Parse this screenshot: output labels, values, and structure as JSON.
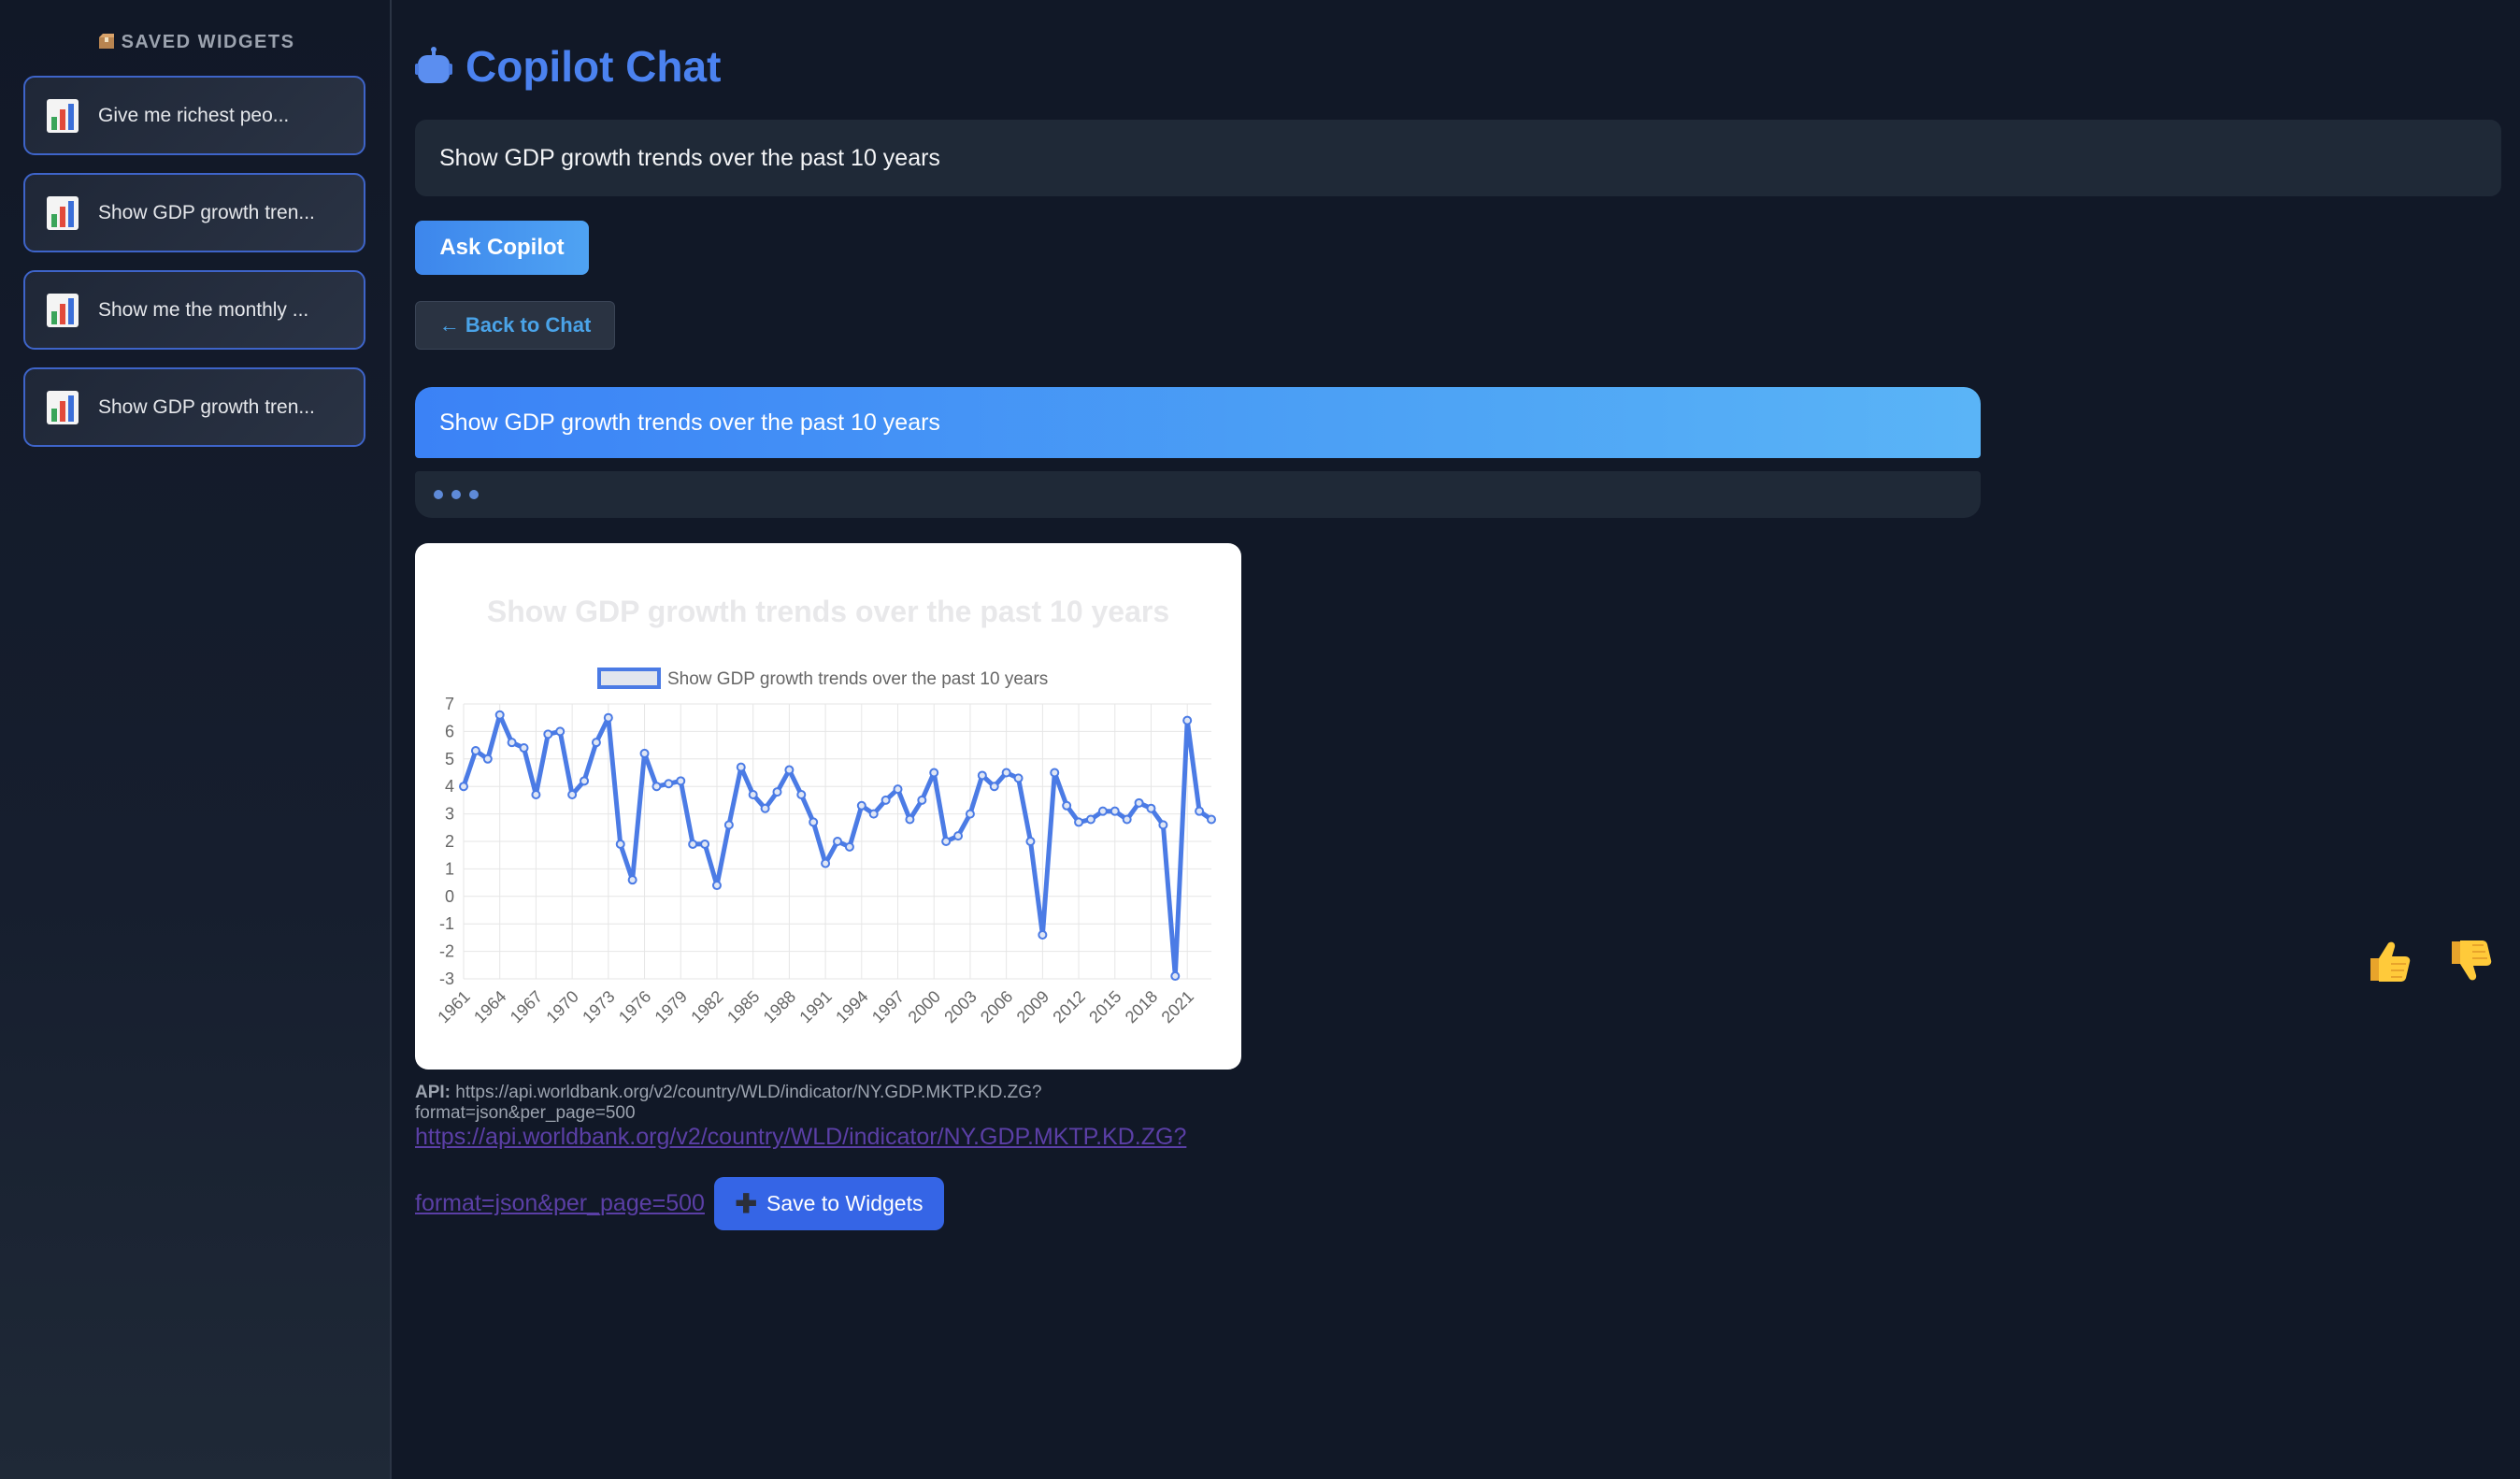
{
  "sidebar": {
    "title": "SAVED WIDGETS",
    "title_icon": "package-icon",
    "items": [
      {
        "label": "Give me richest peo...",
        "icon": "bar-chart-icon"
      },
      {
        "label": "Show GDP growth tren...",
        "icon": "bar-chart-icon"
      },
      {
        "label": "Show me the monthly ...",
        "icon": "bar-chart-icon"
      },
      {
        "label": "Show GDP growth tren...",
        "icon": "bar-chart-icon"
      }
    ]
  },
  "header": {
    "title": "Copilot Chat",
    "icon": "robot-icon"
  },
  "query": {
    "value": "Show GDP growth trends over the past 10 years"
  },
  "buttons": {
    "ask": "Ask Copilot",
    "back": "← Back to Chat",
    "save": "Save to Widgets",
    "save_icon": "plus-icon"
  },
  "chat": {
    "user_message": "Show GDP growth trends over the past 10 years"
  },
  "api": {
    "label": "API:",
    "url_line1": "https://api.worldbank.org/v2/country/WLD/indicator/NY.GDP.MKTP.KD.ZG?",
    "url_line2": "format=json&per_page=500",
    "link_line1": "https://api.worldbank.org/v2/country/WLD/indicator/NY.GDP.MKTP.KD.ZG?",
    "link_line2": "format=json&per_page=500"
  },
  "feedback": {
    "thumbs_up": "thumbs-up-icon",
    "thumbs_down": "thumbs-down-icon"
  },
  "colors": {
    "accent": "#3b82f6",
    "line": "#4b7be5",
    "background": "#111827"
  },
  "chart_data": {
    "type": "line",
    "title": "Show GDP growth trends over the past 10 years",
    "legend": "top",
    "xlabel": "",
    "ylabel": "",
    "ylim": [
      -3,
      7
    ],
    "yticks": [
      7,
      6,
      5,
      4,
      3,
      2,
      1,
      0,
      -1,
      -2,
      -3
    ],
    "xtick_labels": [
      "1961",
      "1964",
      "1967",
      "1970",
      "1973",
      "1976",
      "1979",
      "1982",
      "1985",
      "1988",
      "1991",
      "1994",
      "1997",
      "2000",
      "2003",
      "2006",
      "2009",
      "2012",
      "2015",
      "2018",
      "2021"
    ],
    "x": [
      1961,
      1962,
      1963,
      1964,
      1965,
      1966,
      1967,
      1968,
      1969,
      1970,
      1971,
      1972,
      1973,
      1974,
      1975,
      1976,
      1977,
      1978,
      1979,
      1980,
      1981,
      1982,
      1983,
      1984,
      1985,
      1986,
      1987,
      1988,
      1989,
      1990,
      1991,
      1992,
      1993,
      1994,
      1995,
      1996,
      1997,
      1998,
      1999,
      2000,
      2001,
      2002,
      2003,
      2004,
      2005,
      2006,
      2007,
      2008,
      2009,
      2010,
      2011,
      2012,
      2013,
      2014,
      2015,
      2016,
      2017,
      2018,
      2019,
      2020,
      2021,
      2022,
      2023
    ],
    "series": [
      {
        "name": "Show GDP growth trends over the past 10 years",
        "values": [
          4.0,
          5.3,
          5.0,
          6.6,
          5.6,
          5.4,
          3.7,
          5.9,
          6.0,
          3.7,
          4.2,
          5.6,
          6.5,
          1.9,
          0.6,
          5.2,
          4.0,
          4.1,
          4.2,
          1.9,
          1.9,
          0.4,
          2.6,
          4.7,
          3.7,
          3.2,
          3.8,
          4.6,
          3.7,
          2.7,
          1.2,
          2.0,
          1.8,
          3.3,
          3.0,
          3.5,
          3.9,
          2.8,
          3.5,
          4.5,
          2.0,
          2.2,
          3.0,
          4.4,
          4.0,
          4.5,
          4.3,
          2.0,
          -1.4,
          4.5,
          3.3,
          2.7,
          2.8,
          3.1,
          3.1,
          2.8,
          3.4,
          3.2,
          2.6,
          -2.9,
          6.4,
          3.1,
          2.8
        ]
      }
    ]
  }
}
